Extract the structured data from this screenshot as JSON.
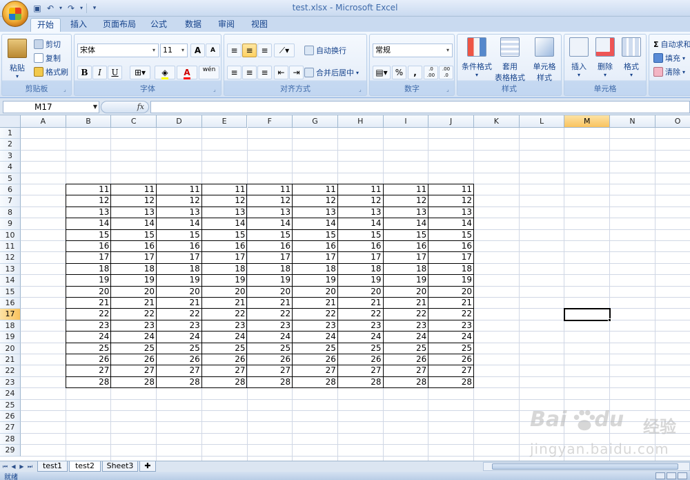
{
  "window": {
    "title": "test.xlsx - Microsoft Excel"
  },
  "qat": {
    "icons": [
      "save-icon",
      "undo-icon",
      "redo-icon",
      "customize-icon"
    ]
  },
  "tabs": [
    {
      "label": "开始",
      "active": true
    },
    {
      "label": "插入"
    },
    {
      "label": "页面布局"
    },
    {
      "label": "公式"
    },
    {
      "label": "数据"
    },
    {
      "label": "审阅"
    },
    {
      "label": "视图"
    }
  ],
  "ribbon": {
    "clipboard": {
      "label": "剪贴板",
      "paste": "粘贴",
      "cut": "剪切",
      "copy": "复制",
      "format_painter": "格式刷"
    },
    "font": {
      "label": "字体",
      "font_name": "宋体",
      "font_size": "11",
      "grow": "A",
      "shrink": "A",
      "bold": "B",
      "italic": "I",
      "underline": "U",
      "font_color": "A",
      "phonetic": "wén"
    },
    "alignment": {
      "label": "对齐方式",
      "wrap": "自动换行",
      "merge": "合并后居中"
    },
    "number": {
      "label": "数字",
      "format": "常规",
      "percent": "%",
      "comma": ",",
      "inc_decimal": ".0 .00",
      "dec_decimal": ".00 .0"
    },
    "styles": {
      "label": "样式",
      "conditional": "条件格式",
      "table_line1": "套用",
      "table_line2": "表格格式",
      "cell_line1": "单元格",
      "cell_line2": "样式"
    },
    "cells": {
      "label": "单元格",
      "insert": "插入",
      "delete": "删除",
      "format": "格式"
    },
    "editing": {
      "autosum": "自动求和",
      "fill": "填充",
      "clear": "清除"
    }
  },
  "formula_bar": {
    "name_box": "M17",
    "fx": "fx",
    "content": ""
  },
  "sheet": {
    "columns": [
      "A",
      "B",
      "C",
      "D",
      "E",
      "F",
      "G",
      "H",
      "I",
      "J",
      "K",
      "L",
      "M",
      "N",
      "O"
    ],
    "selected_column": "M",
    "rows": [
      "1",
      "2",
      "3",
      "4",
      "5",
      "6",
      "7",
      "8",
      "9",
      "10",
      "11",
      "12",
      "13",
      "14",
      "15",
      "16",
      "17",
      "18",
      "19",
      "20",
      "21",
      "22",
      "23",
      "24",
      "25",
      "26",
      "27",
      "28",
      "29"
    ],
    "selected_row": "17",
    "table_rows": [
      [
        "11",
        "11",
        "11",
        "11",
        "11",
        "11",
        "11",
        "11",
        "11"
      ],
      [
        "12",
        "12",
        "12",
        "12",
        "12",
        "12",
        "12",
        "12",
        "12"
      ],
      [
        "13",
        "13",
        "13",
        "13",
        "13",
        "13",
        "13",
        "13",
        "13"
      ],
      [
        "14",
        "14",
        "14",
        "14",
        "14",
        "14",
        "14",
        "14",
        "14"
      ],
      [
        "15",
        "15",
        "15",
        "15",
        "15",
        "15",
        "15",
        "15",
        "15"
      ],
      [
        "16",
        "16",
        "16",
        "16",
        "16",
        "16",
        "16",
        "16",
        "16"
      ],
      [
        "17",
        "17",
        "17",
        "17",
        "17",
        "17",
        "17",
        "17",
        "17"
      ],
      [
        "18",
        "18",
        "18",
        "18",
        "18",
        "18",
        "18",
        "18",
        "18"
      ],
      [
        "19",
        "19",
        "19",
        "19",
        "19",
        "19",
        "19",
        "19",
        "19"
      ],
      [
        "20",
        "20",
        "20",
        "20",
        "20",
        "20",
        "20",
        "20",
        "20"
      ],
      [
        "21",
        "21",
        "21",
        "21",
        "21",
        "21",
        "21",
        "21",
        "21"
      ],
      [
        "22",
        "22",
        "22",
        "22",
        "22",
        "22",
        "22",
        "22",
        "22"
      ],
      [
        "23",
        "23",
        "23",
        "23",
        "23",
        "23",
        "23",
        "23",
        "23"
      ],
      [
        "24",
        "24",
        "24",
        "24",
        "24",
        "24",
        "24",
        "24",
        "24"
      ],
      [
        "25",
        "25",
        "25",
        "25",
        "25",
        "25",
        "25",
        "25",
        "25"
      ],
      [
        "26",
        "26",
        "26",
        "26",
        "26",
        "26",
        "26",
        "26",
        "26"
      ],
      [
        "27",
        "27",
        "27",
        "27",
        "27",
        "27",
        "27",
        "27",
        "27"
      ],
      [
        "28",
        "28",
        "28",
        "28",
        "28",
        "28",
        "28",
        "28",
        "28"
      ]
    ]
  },
  "sheet_tabs": [
    {
      "label": "test1"
    },
    {
      "label": "test2",
      "active": true
    },
    {
      "label": "Sheet3"
    }
  ],
  "status": {
    "text": "就绪"
  },
  "watermark": {
    "logo_left": "Bai",
    "logo_right": "du",
    "cn": "经验",
    "url": "jingyan.baidu.com"
  }
}
